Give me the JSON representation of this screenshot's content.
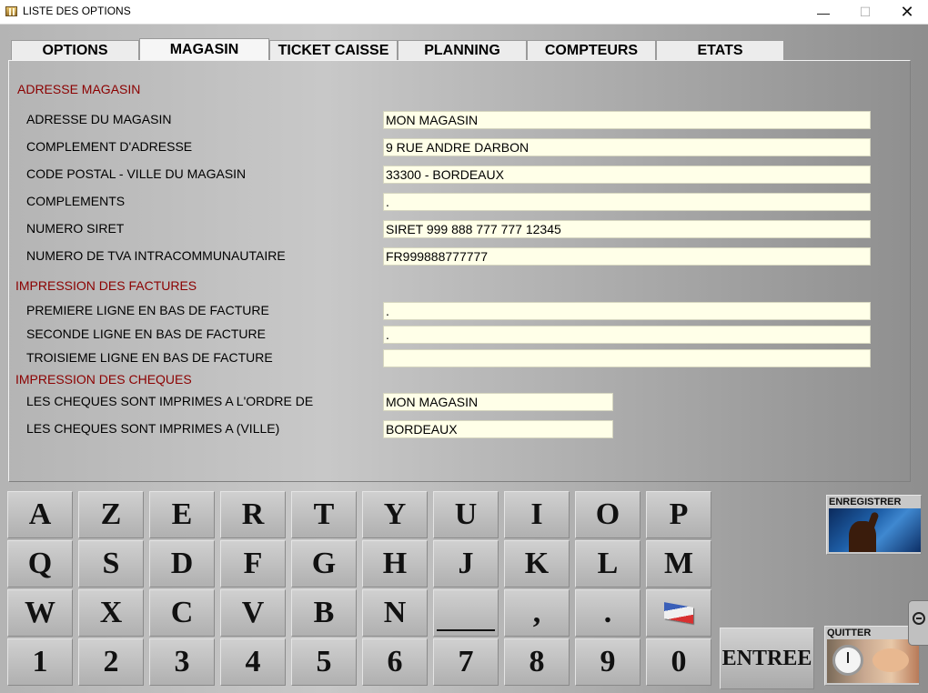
{
  "window": {
    "title": "LISTE DES OPTIONS",
    "minimize_glyph": "—",
    "maximize_glyph": "☐",
    "close_glyph": "✕"
  },
  "tabs": [
    {
      "label": "OPTIONS",
      "active": false
    },
    {
      "label": "MAGASIN",
      "active": true
    },
    {
      "label": "TICKET CAISSE",
      "active": false
    },
    {
      "label": "PLANNING",
      "active": false
    },
    {
      "label": "COMPTEURS",
      "active": false
    },
    {
      "label": "ETATS",
      "active": false
    }
  ],
  "sections": {
    "adresse": "ADRESSE MAGASIN",
    "factures": "IMPRESSION DES FACTURES",
    "cheques": "IMPRESSION DES CHEQUES"
  },
  "fields": {
    "adresse": {
      "label": "ADRESSE DU MAGASIN",
      "value": "MON MAGASIN"
    },
    "complement": {
      "label": "COMPLEMENT D'ADRESSE",
      "value": "9 RUE ANDRE DARBON"
    },
    "cp_ville": {
      "label": "CODE POSTAL - VILLE DU MAGASIN",
      "value": "33300 - BORDEAUX"
    },
    "complements": {
      "label": "COMPLEMENTS",
      "value": "."
    },
    "siret": {
      "label": "NUMERO SIRET",
      "value": "SIRET 999 888 777 777 12345"
    },
    "tva": {
      "label": "NUMERO DE TVA INTRACOMMUNAUTAIRE",
      "value": "FR999888777777"
    },
    "ligne1": {
      "label": "PREMIERE LIGNE EN BAS DE FACTURE",
      "value": "."
    },
    "ligne2": {
      "label": "SECONDE LIGNE EN BAS DE FACTURE",
      "value": "."
    },
    "ligne3": {
      "label": "TROISIEME LIGNE EN BAS DE FACTURE",
      "value": ""
    },
    "ordre": {
      "label": "LES CHEQUES SONT IMPRIMES A L'ORDRE DE",
      "value": "MON MAGASIN"
    },
    "ville": {
      "label": "LES CHEQUES SONT IMPRIMES A (VILLE)",
      "value": "BORDEAUX"
    }
  },
  "keyboard": {
    "row1": [
      "A",
      "Z",
      "E",
      "R",
      "T",
      "Y",
      "U",
      "I",
      "O",
      "P"
    ],
    "row2": [
      "Q",
      "S",
      "D",
      "F",
      "G",
      "H",
      "J",
      "K",
      "L",
      "M"
    ],
    "row3": [
      "W",
      "X",
      "C",
      "V",
      "B",
      "N",
      "",
      ",",
      ".",
      ""
    ],
    "row4": [
      "1",
      "2",
      "3",
      "4",
      "5",
      "6",
      "7",
      "8",
      "9",
      "0"
    ],
    "enter": "ENTREE"
  },
  "buttons": {
    "save": "ENREGISTRER",
    "quit": "QUITTER"
  }
}
